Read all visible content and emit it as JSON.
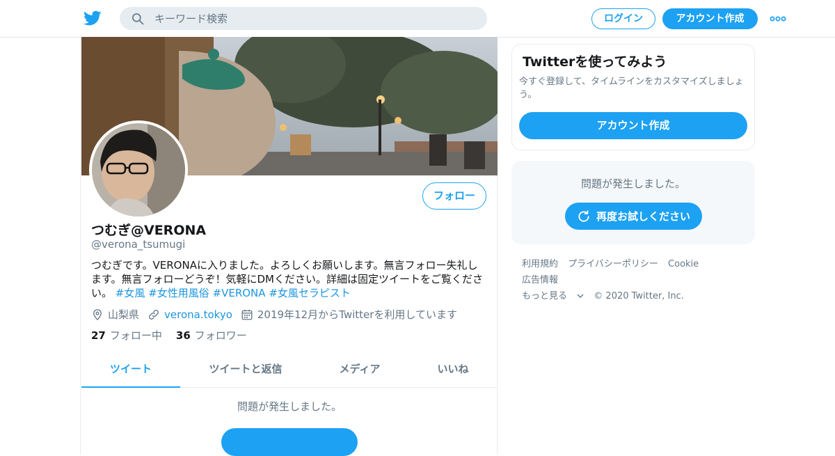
{
  "header": {
    "search_placeholder": "キーワード検索",
    "login_label": "ログイン",
    "signup_label": "アカウント作成"
  },
  "profile": {
    "display_name": "つむぎ@VERONA",
    "handle": "@verona_tsumugi",
    "follow_label": "フォロー",
    "bio_text": "つむぎです。VERONAに入りました。よろしくお願いします。無言フォロー失礼します。無言フォローどうぞ！気軽にDMください。詳細は固定ツイートをご覧ください。",
    "hashtags": [
      "#女風",
      "#女性用風俗",
      "#VERONA",
      "#女風セラピスト"
    ],
    "location": "山梨県",
    "website": "verona.tokyo",
    "joined": "2019年12月からTwitterを利用しています",
    "following_count": "27",
    "following_label": "フォロー中",
    "followers_count": "36",
    "followers_label": "フォロワー"
  },
  "tabs": [
    {
      "label": "ツイート",
      "active": true
    },
    {
      "label": "ツイートと返信",
      "active": false
    },
    {
      "label": "メディア",
      "active": false
    },
    {
      "label": "いいね",
      "active": false
    }
  ],
  "main_error": {
    "message": "問題が発生しました。"
  },
  "sidebar": {
    "card_title": "Twitterを使ってみよう",
    "card_desc": "今すぐ登録して、タイムラインをカスタマイズしましょう。",
    "card_button": "アカウント作成",
    "error_message": "問題が発生しました。",
    "retry_label": "再度お試しください"
  },
  "footer": {
    "links": [
      "利用規約",
      "プライバシーポリシー",
      "Cookie",
      "広告情報"
    ],
    "more": "もっと見る",
    "copyright": "© 2020 Twitter, Inc."
  },
  "colors": {
    "accent": "#1da1f2",
    "link": "#1b95e0",
    "muted": "#657786"
  }
}
